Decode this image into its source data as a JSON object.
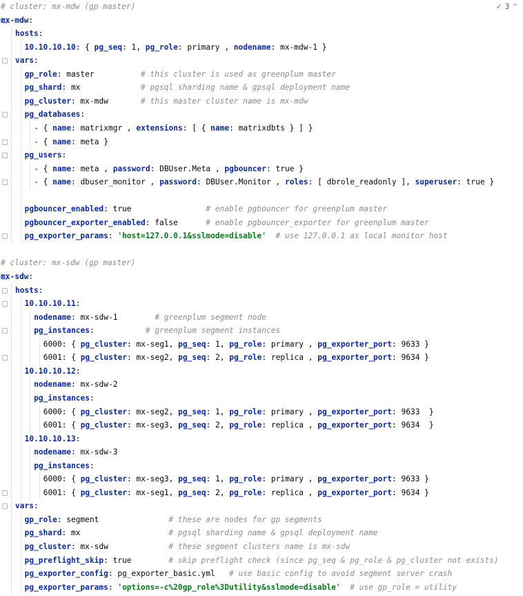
{
  "inspection": {
    "check": "✓",
    "count": "3",
    "nav_icon": "chevron-up-icon",
    "nav_glyph": "^"
  },
  "lines": [
    {
      "d": 0,
      "p": [
        [
          "c",
          "# cluster: mx-mdw (gp master)"
        ]
      ]
    },
    {
      "d": 0,
      "f": 1,
      "p": [
        [
          "k",
          "mx-mdw"
        ],
        [
          "v",
          ":"
        ]
      ]
    },
    {
      "d": 1,
      "p": [
        [
          "k",
          "hosts"
        ],
        [
          "v",
          ":"
        ]
      ]
    },
    {
      "d": 2,
      "p": [
        [
          "k",
          "10.10.10.10"
        ],
        [
          "v",
          ": { "
        ],
        [
          "k",
          "pg_seq"
        ],
        [
          "v",
          ": 1, "
        ],
        [
          "k",
          "pg_role"
        ],
        [
          "v",
          ": primary , "
        ],
        [
          "k",
          "nodename"
        ],
        [
          "v",
          ": mx-mdw-1 }"
        ]
      ]
    },
    {
      "d": 1,
      "f": 1,
      "p": [
        [
          "k",
          "vars"
        ],
        [
          "v",
          ":"
        ]
      ]
    },
    {
      "d": 2,
      "p": [
        [
          "k",
          "gp_role"
        ],
        [
          "v",
          ": master          "
        ],
        [
          "c",
          "# this cluster is used as greenplum master"
        ]
      ]
    },
    {
      "d": 2,
      "p": [
        [
          "k",
          "pg_shard"
        ],
        [
          "v",
          ": mx             "
        ],
        [
          "c",
          "# pgsql sharding name & gpsql deployment name"
        ]
      ]
    },
    {
      "d": 2,
      "p": [
        [
          "k",
          "pg_cluster"
        ],
        [
          "v",
          ": mx-mdw       "
        ],
        [
          "c",
          "# this master cluster name is mx-mdw"
        ]
      ]
    },
    {
      "d": 2,
      "f": 1,
      "p": [
        [
          "k",
          "pg_databases"
        ],
        [
          "v",
          ":"
        ]
      ]
    },
    {
      "d": 3,
      "p": [
        [
          "v",
          "- { "
        ],
        [
          "k",
          "name"
        ],
        [
          "v",
          ": matrixmgr , "
        ],
        [
          "k",
          "extensions"
        ],
        [
          "v",
          ": [ { "
        ],
        [
          "k",
          "name"
        ],
        [
          "v",
          ": matrixdbts } ] }"
        ]
      ]
    },
    {
      "d": 3,
      "f": 1,
      "p": [
        [
          "v",
          "- { "
        ],
        [
          "k",
          "name"
        ],
        [
          "v",
          ": meta }"
        ]
      ]
    },
    {
      "d": 2,
      "f": 1,
      "p": [
        [
          "k",
          "pg_users"
        ],
        [
          "v",
          ":"
        ]
      ]
    },
    {
      "d": 3,
      "p": [
        [
          "v",
          "- { "
        ],
        [
          "k",
          "name"
        ],
        [
          "v",
          ": meta , "
        ],
        [
          "k",
          "password"
        ],
        [
          "v",
          ": DBUser.Meta , "
        ],
        [
          "k",
          "pgbouncer"
        ],
        [
          "v",
          ": true }"
        ]
      ]
    },
    {
      "d": 3,
      "f": 1,
      "p": [
        [
          "v",
          "- { "
        ],
        [
          "k",
          "name"
        ],
        [
          "v",
          ": dbuser_monitor , "
        ],
        [
          "k",
          "password"
        ],
        [
          "v",
          ": DBUser.Monitor , "
        ],
        [
          "k",
          "roles"
        ],
        [
          "v",
          ": [ dbrole_readonly ], "
        ],
        [
          "k",
          "superuser"
        ],
        [
          "v",
          ": true }"
        ]
      ]
    },
    {
      "d": 2,
      "p": []
    },
    {
      "d": 2,
      "p": [
        [
          "k",
          "pgbouncer_enabled"
        ],
        [
          "v",
          ": true                "
        ],
        [
          "c",
          "# enable pgbouncer for greenplum master"
        ]
      ]
    },
    {
      "d": 2,
      "p": [
        [
          "k",
          "pgbouncer_exporter_enabled"
        ],
        [
          "v",
          ": false      "
        ],
        [
          "c",
          "# enable pgbouncer_exporter for greenplum master"
        ]
      ]
    },
    {
      "d": 2,
      "f": 1,
      "p": [
        [
          "k",
          "pg_exporter_params"
        ],
        [
          "v",
          ": "
        ],
        [
          "s",
          "'host=127.0.0.1&sslmode=disable'"
        ],
        [
          "v",
          "  "
        ],
        [
          "c",
          "# use 127.0.0.1 as local monitor host"
        ]
      ]
    },
    {
      "d": 0,
      "p": []
    },
    {
      "d": 0,
      "p": [
        [
          "c",
          "# cluster: mx-sdw (gp master)"
        ]
      ]
    },
    {
      "d": 0,
      "f": 1,
      "p": [
        [
          "k",
          "mx-sdw"
        ],
        [
          "v",
          ":"
        ]
      ]
    },
    {
      "d": 1,
      "f": 1,
      "p": [
        [
          "k",
          "hosts"
        ],
        [
          "v",
          ":"
        ]
      ]
    },
    {
      "d": 2,
      "f": 1,
      "p": [
        [
          "k",
          "10.10.10.11"
        ],
        [
          "v",
          ":"
        ]
      ]
    },
    {
      "d": 3,
      "p": [
        [
          "k",
          "nodename"
        ],
        [
          "v",
          ": mx-sdw-1        "
        ],
        [
          "c",
          "# greenplum segment node"
        ]
      ]
    },
    {
      "d": 3,
      "f": 1,
      "p": [
        [
          "k",
          "pg_instances"
        ],
        [
          "v",
          ":           "
        ],
        [
          "c",
          "# greenplum segment instances"
        ]
      ]
    },
    {
      "d": 4,
      "p": [
        [
          "v",
          "6000: { "
        ],
        [
          "k",
          "pg_cluster"
        ],
        [
          "v",
          ": mx-seg1, "
        ],
        [
          "k",
          "pg_seq"
        ],
        [
          "v",
          ": 1, "
        ],
        [
          "k",
          "pg_role"
        ],
        [
          "v",
          ": primary , "
        ],
        [
          "k",
          "pg_exporter_port"
        ],
        [
          "v",
          ": 9633 }"
        ]
      ]
    },
    {
      "d": 4,
      "f": 1,
      "p": [
        [
          "v",
          "6001: { "
        ],
        [
          "k",
          "pg_cluster"
        ],
        [
          "v",
          ": mx-seg2, "
        ],
        [
          "k",
          "pg_seq"
        ],
        [
          "v",
          ": 2, "
        ],
        [
          "k",
          "pg_role"
        ],
        [
          "v",
          ": replica , "
        ],
        [
          "k",
          "pg_exporter_port"
        ],
        [
          "v",
          ": 9634 }"
        ]
      ]
    },
    {
      "d": 2,
      "p": [
        [
          "k",
          "10.10.10.12"
        ],
        [
          "v",
          ":"
        ]
      ]
    },
    {
      "d": 3,
      "p": [
        [
          "k",
          "nodename"
        ],
        [
          "v",
          ": mx-sdw-2"
        ]
      ]
    },
    {
      "d": 3,
      "p": [
        [
          "k",
          "pg_instances"
        ],
        [
          "v",
          ":"
        ]
      ]
    },
    {
      "d": 4,
      "p": [
        [
          "v",
          "6000: { "
        ],
        [
          "k",
          "pg_cluster"
        ],
        [
          "v",
          ": mx-seg2, "
        ],
        [
          "k",
          "pg_seq"
        ],
        [
          "v",
          ": 1, "
        ],
        [
          "k",
          "pg_role"
        ],
        [
          "v",
          ": primary , "
        ],
        [
          "k",
          "pg_exporter_port"
        ],
        [
          "v",
          ": 9633  }"
        ]
      ]
    },
    {
      "d": 4,
      "p": [
        [
          "v",
          "6001: { "
        ],
        [
          "k",
          "pg_cluster"
        ],
        [
          "v",
          ": mx-seg3, "
        ],
        [
          "k",
          "pg_seq"
        ],
        [
          "v",
          ": 2, "
        ],
        [
          "k",
          "pg_role"
        ],
        [
          "v",
          ": replica , "
        ],
        [
          "k",
          "pg_exporter_port"
        ],
        [
          "v",
          ": 9634  }"
        ]
      ]
    },
    {
      "d": 2,
      "p": [
        [
          "k",
          "10.10.10.13"
        ],
        [
          "v",
          ":"
        ]
      ]
    },
    {
      "d": 3,
      "p": [
        [
          "k",
          "nodename"
        ],
        [
          "v",
          ": mx-sdw-3"
        ]
      ]
    },
    {
      "d": 3,
      "p": [
        [
          "k",
          "pg_instances"
        ],
        [
          "v",
          ":"
        ]
      ]
    },
    {
      "d": 4,
      "p": [
        [
          "v",
          "6000: { "
        ],
        [
          "k",
          "pg_cluster"
        ],
        [
          "v",
          ": mx-seg3, "
        ],
        [
          "k",
          "pg_seq"
        ],
        [
          "v",
          ": 1, "
        ],
        [
          "k",
          "pg_role"
        ],
        [
          "v",
          ": primary , "
        ],
        [
          "k",
          "pg_exporter_port"
        ],
        [
          "v",
          ": 9633 }"
        ]
      ]
    },
    {
      "d": 4,
      "f": 1,
      "p": [
        [
          "v",
          "6001: { "
        ],
        [
          "k",
          "pg_cluster"
        ],
        [
          "v",
          ": mx-seg1, "
        ],
        [
          "k",
          "pg_seq"
        ],
        [
          "v",
          ": 2, "
        ],
        [
          "k",
          "pg_role"
        ],
        [
          "v",
          ": replica , "
        ],
        [
          "k",
          "pg_exporter_port"
        ],
        [
          "v",
          ": 9634 }"
        ]
      ]
    },
    {
      "d": 1,
      "f": 1,
      "p": [
        [
          "k",
          "vars"
        ],
        [
          "v",
          ":"
        ]
      ]
    },
    {
      "d": 2,
      "p": [
        [
          "k",
          "gp_role"
        ],
        [
          "v",
          ": segment               "
        ],
        [
          "c",
          "# these are nodes for gp segments"
        ]
      ]
    },
    {
      "d": 2,
      "p": [
        [
          "k",
          "pg_shard"
        ],
        [
          "v",
          ": mx                   "
        ],
        [
          "c",
          "# pgsql sharding name & gpsql deployment name"
        ]
      ]
    },
    {
      "d": 2,
      "p": [
        [
          "k",
          "pg_cluster"
        ],
        [
          "v",
          ": mx-sdw             "
        ],
        [
          "c",
          "# these segment clusters name is mx-sdw"
        ]
      ]
    },
    {
      "d": 2,
      "p": [
        [
          "k",
          "pg_preflight_skip"
        ],
        [
          "v",
          ": true        "
        ],
        [
          "c",
          "# skip preflight check (since pg_seq & pg_role & pg_cluster not exists)"
        ]
      ]
    },
    {
      "d": 2,
      "p": [
        [
          "k",
          "pg_exporter_config"
        ],
        [
          "v",
          ": pg_exporter_basic.yml   "
        ],
        [
          "c",
          "# use basic config to avoid segment server crash"
        ]
      ]
    },
    {
      "d": 2,
      "p": [
        [
          "k",
          "pg_exporter_params"
        ],
        [
          "v",
          ": "
        ],
        [
          "s",
          "'options=-c%20gp_role%3Dutility&sslmode=disable'"
        ],
        [
          "v",
          "  "
        ],
        [
          "c",
          "# use gp_role = utility"
        ]
      ]
    }
  ]
}
